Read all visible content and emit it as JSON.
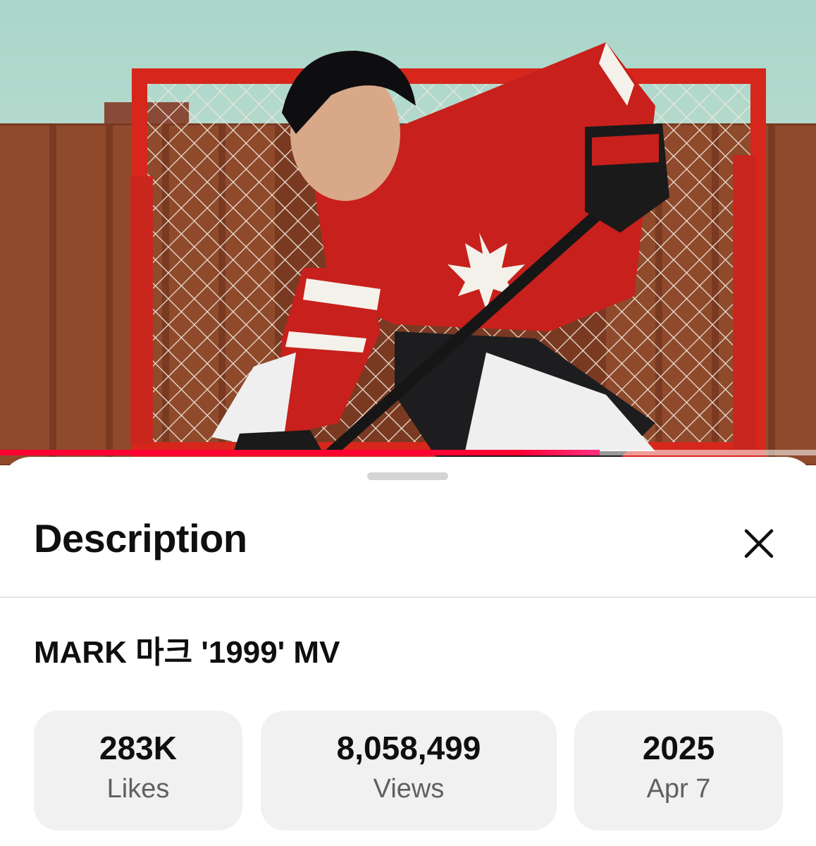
{
  "player": {
    "progress": 0.735
  },
  "description_panel": {
    "title": "Description",
    "video_title": "MARK 마크 '1999' MV",
    "stats": {
      "likes": {
        "value": "283K",
        "label": "Likes"
      },
      "views": {
        "value": "8,058,499",
        "label": "Views"
      },
      "date": {
        "value": "2025",
        "label": "Apr 7"
      }
    }
  },
  "icons": {
    "close": "close-icon"
  },
  "colors": {
    "progress": "#ff0033",
    "stat_background": "#f1f1f1"
  }
}
